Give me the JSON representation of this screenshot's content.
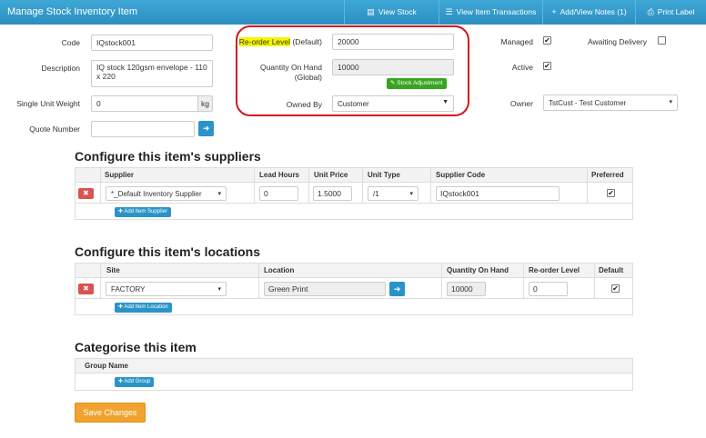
{
  "header": {
    "title": "Manage Stock Inventory Item",
    "view_stock": "View Stock",
    "view_item_transactions": "View Item Transactions",
    "add_view_notes": "Add/View Notes (1)",
    "print_label": "Print Label"
  },
  "form": {
    "code_label": "Code",
    "code_value": "IQstock001",
    "description_label": "Description",
    "description_value": "IQ stock 120gsm envelope - 110 x 220",
    "weight_label": "Single Unit Weight",
    "weight_value": "0",
    "weight_unit": "kg",
    "quote_label": "Quote Number",
    "quote_value": "",
    "reorder_label_highlight": "Re-order Level",
    "reorder_label_suffix": "(Default)",
    "reorder_value": "20000",
    "qoh_label_line1": "Quantity On Hand",
    "qoh_label_line2": "(Global)",
    "qoh_value": "10000",
    "stock_adjustment": "Stock Adjustment",
    "owned_by_label": "Owned By",
    "owned_by_value": "Customer",
    "managed_label": "Managed",
    "managed_checked": true,
    "awaiting_delivery_label": "Awaiting Delivery",
    "awaiting_delivery_checked": false,
    "active_label": "Active",
    "active_checked": true,
    "owner_label": "Owner",
    "owner_value": "TstCust - Test Customer"
  },
  "suppliers": {
    "heading": "Configure this item's suppliers",
    "columns": [
      "Supplier",
      "Lead Hours",
      "Unit Price",
      "Unit Type",
      "Supplier Code",
      "Preferred"
    ],
    "rows": [
      {
        "supplier": "*_Default Inventory Supplier",
        "lead_hours": "0",
        "unit_price": "1.5000",
        "unit_type": "/1",
        "supplier_code": "IQstock001",
        "preferred": true
      }
    ],
    "add_button": "Add Item Supplier"
  },
  "locations": {
    "heading": "Configure this item's locations",
    "columns": [
      "Site",
      "Location",
      "Quantity On Hand",
      "Re-order Level",
      "Default"
    ],
    "rows": [
      {
        "site": "FACTORY",
        "location": "Green Print",
        "quantity_on_hand": "10000",
        "reorder_level": "0",
        "default": true
      }
    ],
    "add_button": "Add Item Location"
  },
  "categorise": {
    "heading": "Categorise this item",
    "columns": [
      "Group Name"
    ],
    "add_button": "Add Group"
  },
  "save_button": "Save Changes",
  "colors": {
    "header_blue": "#2b8fc1",
    "highlight_yellow": "#f5f500",
    "annotation_red": "#d9141a",
    "save_orange": "#f0a32f",
    "stock_adjust_green": "#37a51f"
  }
}
